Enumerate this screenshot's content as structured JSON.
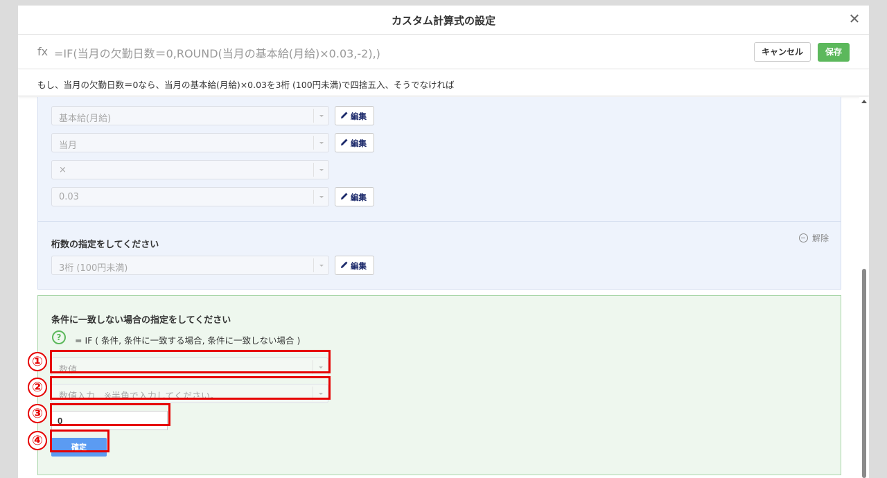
{
  "modal": {
    "title": "カスタム計算式の設定",
    "close_icon": "close-icon"
  },
  "formula": {
    "fx_label": "fx",
    "expression": "=IF(当月の欠勤日数＝0,ROUND(当月の基本給(月給)×0.03,-2),)",
    "cancel_label": "キャンセル",
    "save_label": "保存"
  },
  "description": "もし、当月の欠勤日数＝0なら、当月の基本給(月給)×0.03を3桁 (100円未満)で四捨五入、そうでなければ",
  "operand_rows": [
    {
      "value": "基本給(月給)",
      "has_edit": true
    },
    {
      "value": "当月",
      "has_edit": true
    },
    {
      "value": "×",
      "has_edit": false
    },
    {
      "value": "0.03",
      "has_edit": true
    }
  ],
  "edit_label": "編集",
  "digits": {
    "label": "桁数の指定をしてください",
    "remove_label": "解除",
    "value": "3桁 (100円未満)"
  },
  "else_section": {
    "label": "条件に一致しない場合の指定をしてください",
    "help_text": "= IF ( 条件, 条件に一致する場合, 条件に一致しない場合 )",
    "type_select": "数値",
    "input_select": "数値入力　※半角で入力してください。",
    "number_value": "0",
    "confirm_label": "確定"
  },
  "step_markers": [
    "①",
    "②",
    "③",
    "④"
  ],
  "colors": {
    "accent_green": "#5cb85c",
    "confirm_blue": "#5b9bf2",
    "highlight_red": "#e60000"
  }
}
